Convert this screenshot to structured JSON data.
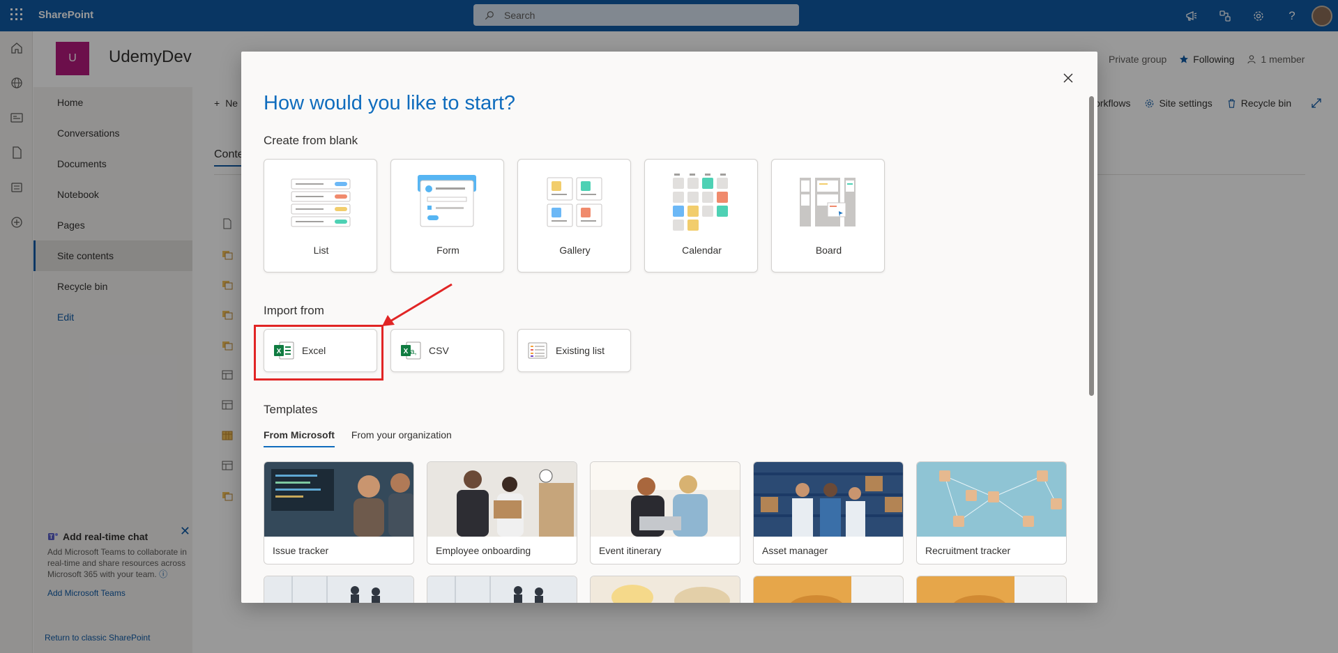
{
  "topbar": {
    "brand": "SharePoint",
    "search_placeholder": "Search",
    "icons": [
      "megaphone-icon",
      "share-icon",
      "gear-icon",
      "help-icon"
    ]
  },
  "site": {
    "logo_letter": "U",
    "title": "UdemyDev",
    "privacy": "Private group",
    "following": "Following",
    "members": "1 member"
  },
  "leftnav": {
    "items": [
      "Home",
      "Conversations",
      "Documents",
      "Notebook",
      "Pages",
      "Site contents",
      "Recycle bin"
    ],
    "edit_label": "Edit",
    "active": "Site contents"
  },
  "chat": {
    "title": "Add real-time chat",
    "description": "Add Microsoft Teams to collaborate in real-time and share resources across Microsoft 365 with your team.",
    "link": "Add Microsoft Teams"
  },
  "classic_link": "Return to classic SharePoint",
  "background": {
    "new_label": "Ne",
    "tab_label": "Conte",
    "cmd": {
      "workflows": "workflows",
      "site_settings": "Site settings",
      "recycle_bin": "Recycle bin"
    }
  },
  "modal": {
    "title": "How would you like to start?",
    "blank_section": "Create from blank",
    "blank_cards": [
      "List",
      "Form",
      "Gallery",
      "Calendar",
      "Board"
    ],
    "import_section": "Import from",
    "import_cards": [
      "Excel",
      "CSV",
      "Existing list"
    ],
    "templates_section": "Templates",
    "tabs": [
      "From Microsoft",
      "From your organization"
    ],
    "active_tab": "From Microsoft",
    "templates": [
      "Issue tracker",
      "Employee onboarding",
      "Event itinerary",
      "Asset manager",
      "Recruitment tracker"
    ]
  },
  "colors": {
    "suite_bar": "#0f5aa6",
    "site_logo": "#b4197d",
    "title_blue": "#0f6cbd",
    "highlight_red": "#e12525"
  }
}
